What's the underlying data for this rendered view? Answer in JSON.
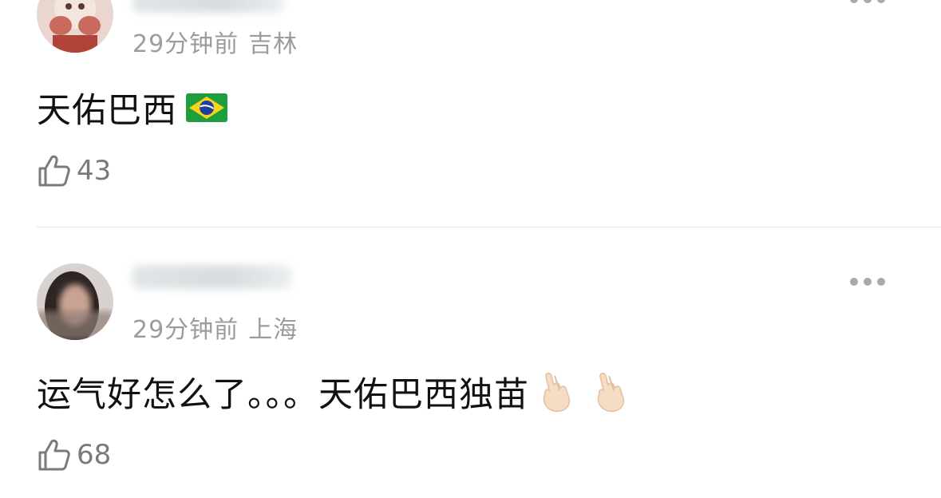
{
  "comments": [
    {
      "time": "29分钟前",
      "location": "吉林",
      "text": "天佑巴西",
      "likes": "43",
      "icons": [
        "avatar-image",
        "flag-brazil-icon",
        "thumbs-up-icon"
      ]
    },
    {
      "time": "29分钟前",
      "location": "上海",
      "text": "运气好怎么了。。。天佑巴西独苗",
      "likes": "68",
      "icons": [
        "avatar-image",
        "more-options-icon",
        "crossed-fingers-icon",
        "crossed-fingers-icon",
        "thumbs-up-icon"
      ]
    }
  ],
  "colors": {
    "meta_text": "#9c9c9c",
    "body_text": "#111111",
    "like_text": "#7a7a7a",
    "divider": "#e4e4e4"
  }
}
